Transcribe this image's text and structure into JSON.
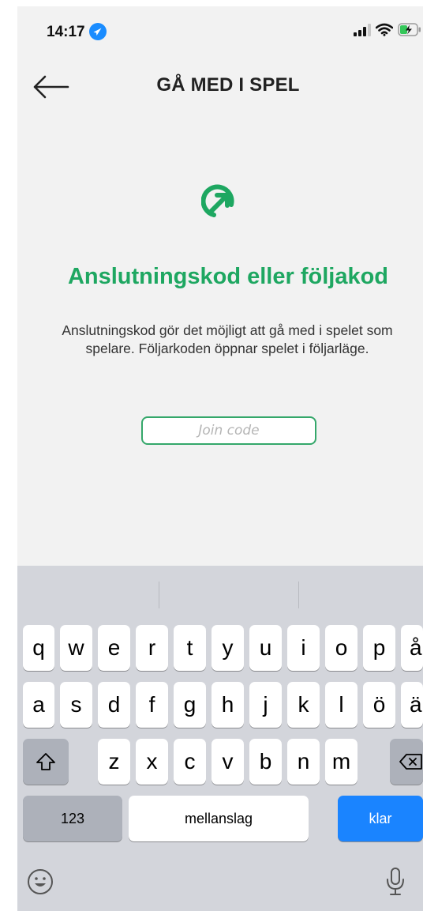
{
  "status_bar": {
    "time": "14:17"
  },
  "header": {
    "title": "GÅ MED I SPEL"
  },
  "content": {
    "headline": "Anslutningskod eller följakod",
    "description": "Anslutningskod gör det möjligt att gå med i spelet som spelare. Följarkoden öppnar spelet i följarläge.",
    "input_placeholder": "Join code",
    "accent_color": "#1ea761"
  },
  "keyboard": {
    "row1": [
      "q",
      "w",
      "e",
      "r",
      "t",
      "y",
      "u",
      "i",
      "o",
      "p",
      "å"
    ],
    "row2": [
      "a",
      "s",
      "d",
      "f",
      "g",
      "h",
      "j",
      "k",
      "l",
      "ö",
      "ä"
    ],
    "row3": [
      "z",
      "x",
      "c",
      "v",
      "b",
      "n",
      "m"
    ],
    "numbers_label": "123",
    "space_label": "mellanslag",
    "return_label": "klar",
    "return_color": "#1a84ff"
  },
  "icons": {
    "back": "arrow-left-icon",
    "location": "location-arrow-icon",
    "signal": "cellular-signal-icon",
    "wifi": "wifi-icon",
    "battery": "battery-charging-icon",
    "logo": "join-game-logo-icon",
    "shift": "shift-icon",
    "delete": "delete-icon",
    "emoji": "emoji-icon",
    "mic": "microphone-icon"
  }
}
